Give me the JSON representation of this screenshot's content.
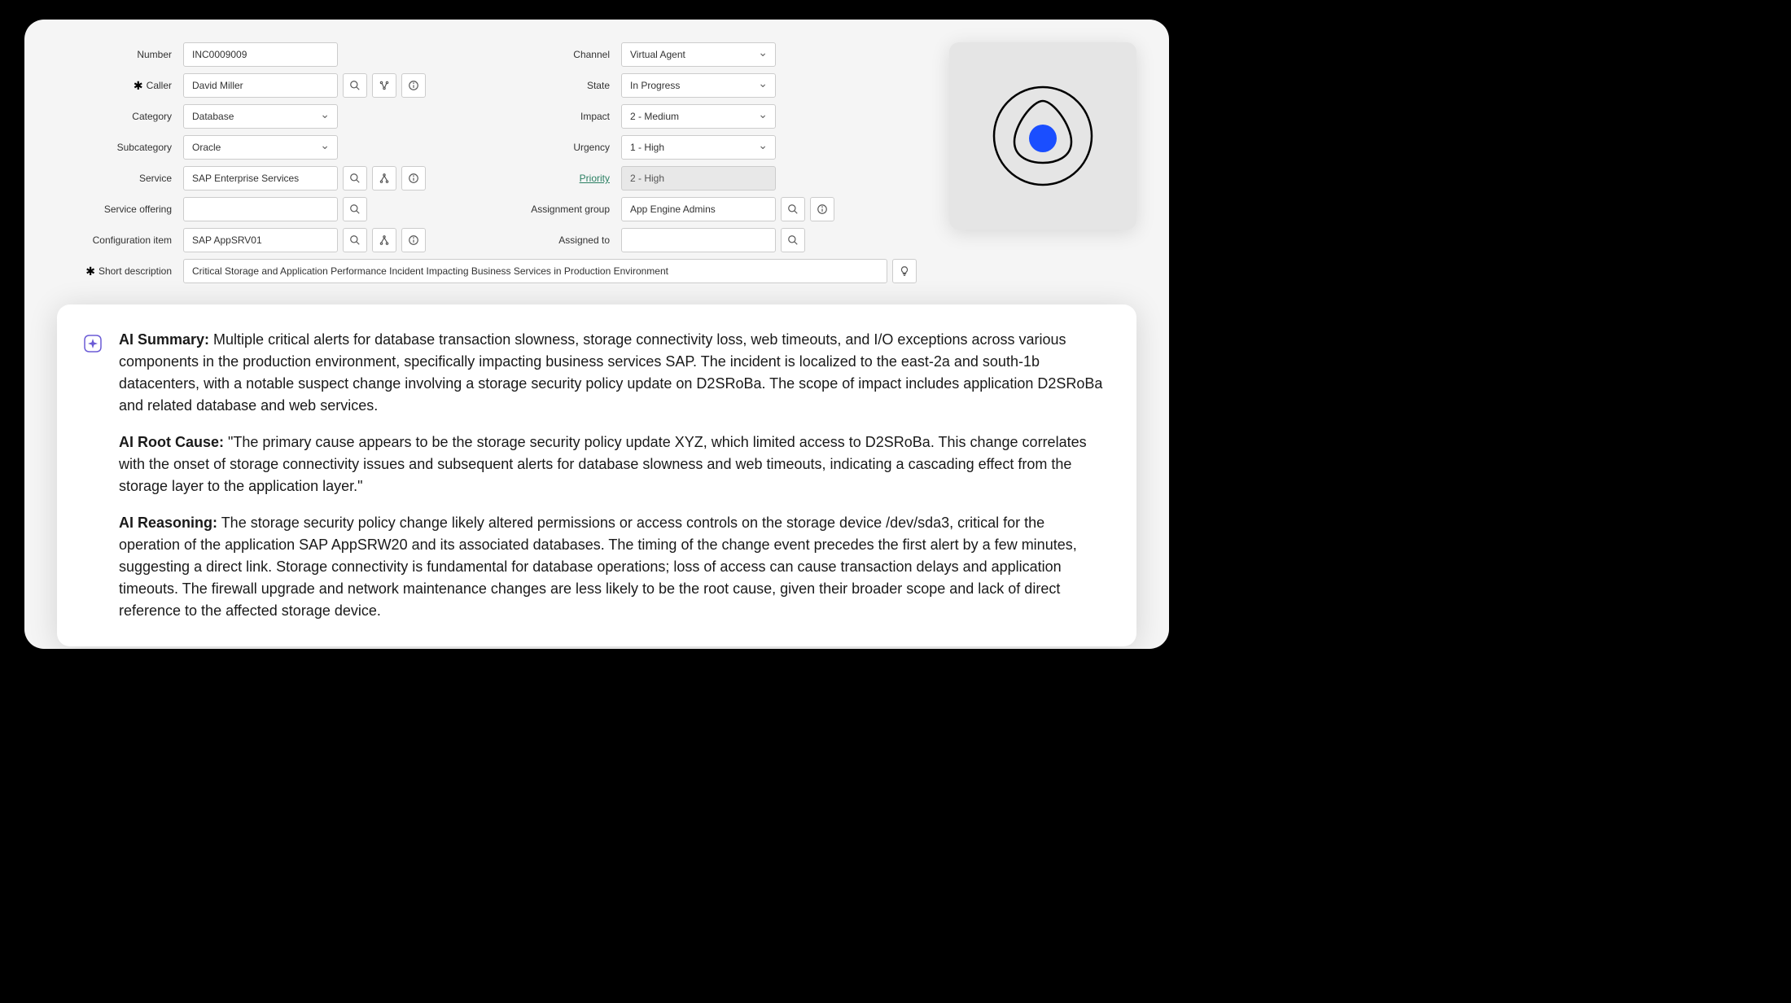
{
  "form": {
    "left": {
      "number": {
        "label": "Number",
        "value": "INC0009009"
      },
      "caller": {
        "label": "Caller",
        "value": "David Miller",
        "required": true
      },
      "category": {
        "label": "Category",
        "value": "Database"
      },
      "subcategory": {
        "label": "Subcategory",
        "value": "Oracle"
      },
      "service": {
        "label": "Service",
        "value": "SAP Enterprise Services"
      },
      "service_offering": {
        "label": "Service offering",
        "value": ""
      },
      "configuration_item": {
        "label": "Configuration item",
        "value": "SAP AppSRV01"
      }
    },
    "right": {
      "channel": {
        "label": "Channel",
        "value": "Virtual Agent"
      },
      "state": {
        "label": "State",
        "value": "In Progress"
      },
      "impact": {
        "label": "Impact",
        "value": "2 - Medium"
      },
      "urgency": {
        "label": "Urgency",
        "value": "1 - High"
      },
      "priority": {
        "label": "Priority",
        "value": "2 - High"
      },
      "assignment_group": {
        "label": "Assignment group",
        "value": "App Engine Admins"
      },
      "assigned_to": {
        "label": "Assigned to",
        "value": ""
      }
    },
    "short_description": {
      "label": "Short description",
      "value": "Critical Storage and Application Performance Incident Impacting Business Services in Production Environment",
      "required": true
    }
  },
  "ai": {
    "summary_label": "AI Summary:",
    "summary_text": " Multiple critical alerts for database transaction slowness, storage connectivity loss, web timeouts, and I/O exceptions across various components in the production environment, specifically impacting business services SAP. The incident is localized to the east-2a and south-1b datacenters, with a notable suspect change involving a storage security policy update on D2SRoBa. The scope of impact includes application D2SRoBa and related database and web services.",
    "rootcause_label": "AI Root Cause:",
    "rootcause_text": " \"The primary cause appears to be the storage security policy update XYZ, which limited access to D2SRoBa. This change correlates with the onset of storage connectivity issues and subsequent alerts for database slowness and web timeouts, indicating a cascading effect from the storage layer to the application layer.\"",
    "reasoning_label": "AI Reasoning:",
    "reasoning_text": " The storage security policy change likely altered permissions or access controls on the storage device /dev/sda3, critical for the operation of the application SAP AppSRW20 and its associated databases. The timing of the change event precedes the first alert by a few minutes, suggesting a direct link. Storage connectivity is fundamental for database operations; loss of access can cause transaction delays and application timeouts. The firewall upgrade and network maintenance changes are less likely to be the root cause, given their broader scope and lack of direct reference to the affected storage device."
  }
}
